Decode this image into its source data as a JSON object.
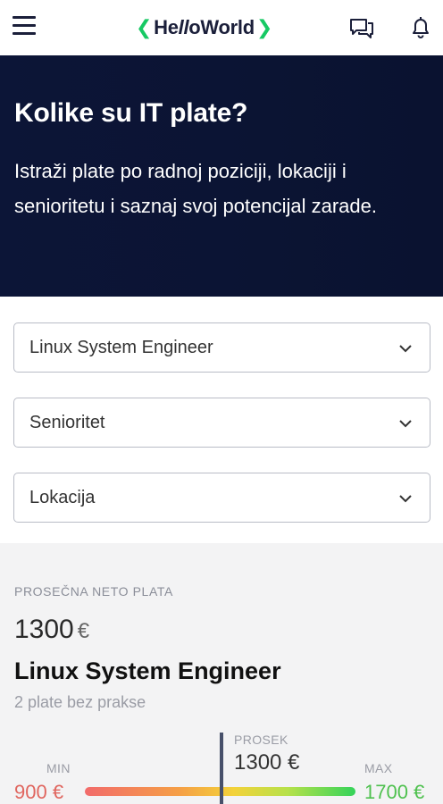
{
  "header": {
    "logo_part1": "He",
    "logo_slash": "ll",
    "logo_part2": "oWorld",
    "logo_chev_left": "❮",
    "logo_chev_right": "❯",
    "icons": [
      "menu-icon",
      "chat-icon",
      "bell-icon"
    ],
    "accent_color": "#17c964"
  },
  "hero": {
    "title": "Kolike su IT plate?",
    "description": "Istraži plate po radnoj poziciji, lokaciji i senioritetu i saznaj svoj potencijal zarade.",
    "background_color": "#0c1537"
  },
  "filters": {
    "position": "Linux System Engineer",
    "seniority": "Senioritet",
    "location": "Lokacija"
  },
  "results": {
    "avg_label": "PROSEČNA NETO PLATA",
    "avg_value": "1300",
    "currency": "€",
    "role_title": "Linux System Engineer",
    "role_subtitle": "2 plate bez prakse",
    "range": {
      "min_label": "MIN",
      "min_value": "900 €",
      "avg_label": "PROSEK",
      "avg_value": "1300 €",
      "max_label": "MAX",
      "max_value": "1700 €",
      "marker_fraction": 0.5
    }
  }
}
